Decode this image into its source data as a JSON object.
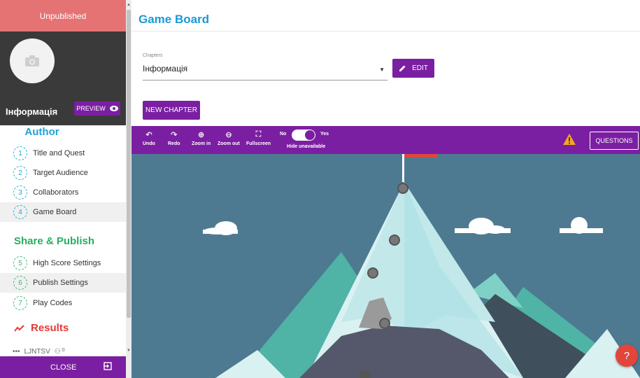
{
  "sidebar": {
    "status": "Unpublished",
    "profile_name": "Інформація",
    "preview_label": "PREVIEW",
    "author_title": "Author",
    "author_items": [
      {
        "num": "1",
        "label": "Title and Quest"
      },
      {
        "num": "2",
        "label": "Target Audience"
      },
      {
        "num": "3",
        "label": "Collaborators"
      },
      {
        "num": "4",
        "label": "Game Board"
      }
    ],
    "share_title": "Share & Publish",
    "share_items": [
      {
        "num": "5",
        "label": "High Score Settings"
      },
      {
        "num": "6",
        "label": "Publish Settings"
      },
      {
        "num": "7",
        "label": "Play Codes"
      }
    ],
    "results_title": "Results",
    "results_entry": "LJNTSV",
    "results_count": "0",
    "close_label": "CLOSE"
  },
  "main": {
    "title": "Game Board",
    "chapters_label": "Chapters",
    "chapters_value": "Інформація",
    "edit_label": "EDIT",
    "new_chapter_label": "NEW CHAPTER"
  },
  "toolbar": {
    "undo": "Undo",
    "redo": "Redo",
    "zoom_in": "Zoom in",
    "zoom_out": "Zoom out",
    "fullscreen": "Fullscreen",
    "toggle_no": "No",
    "toggle_yes": "Yes",
    "hide_unavailable": "Hide unavailable",
    "questions": "QUESTIONS"
  },
  "colors": {
    "purple": "#7b1fa2",
    "unpublished": "#e57373",
    "title_blue": "#1a9ad6",
    "share_green": "#27ae60",
    "results_red": "#e53935",
    "sky": "#4d7a91"
  }
}
